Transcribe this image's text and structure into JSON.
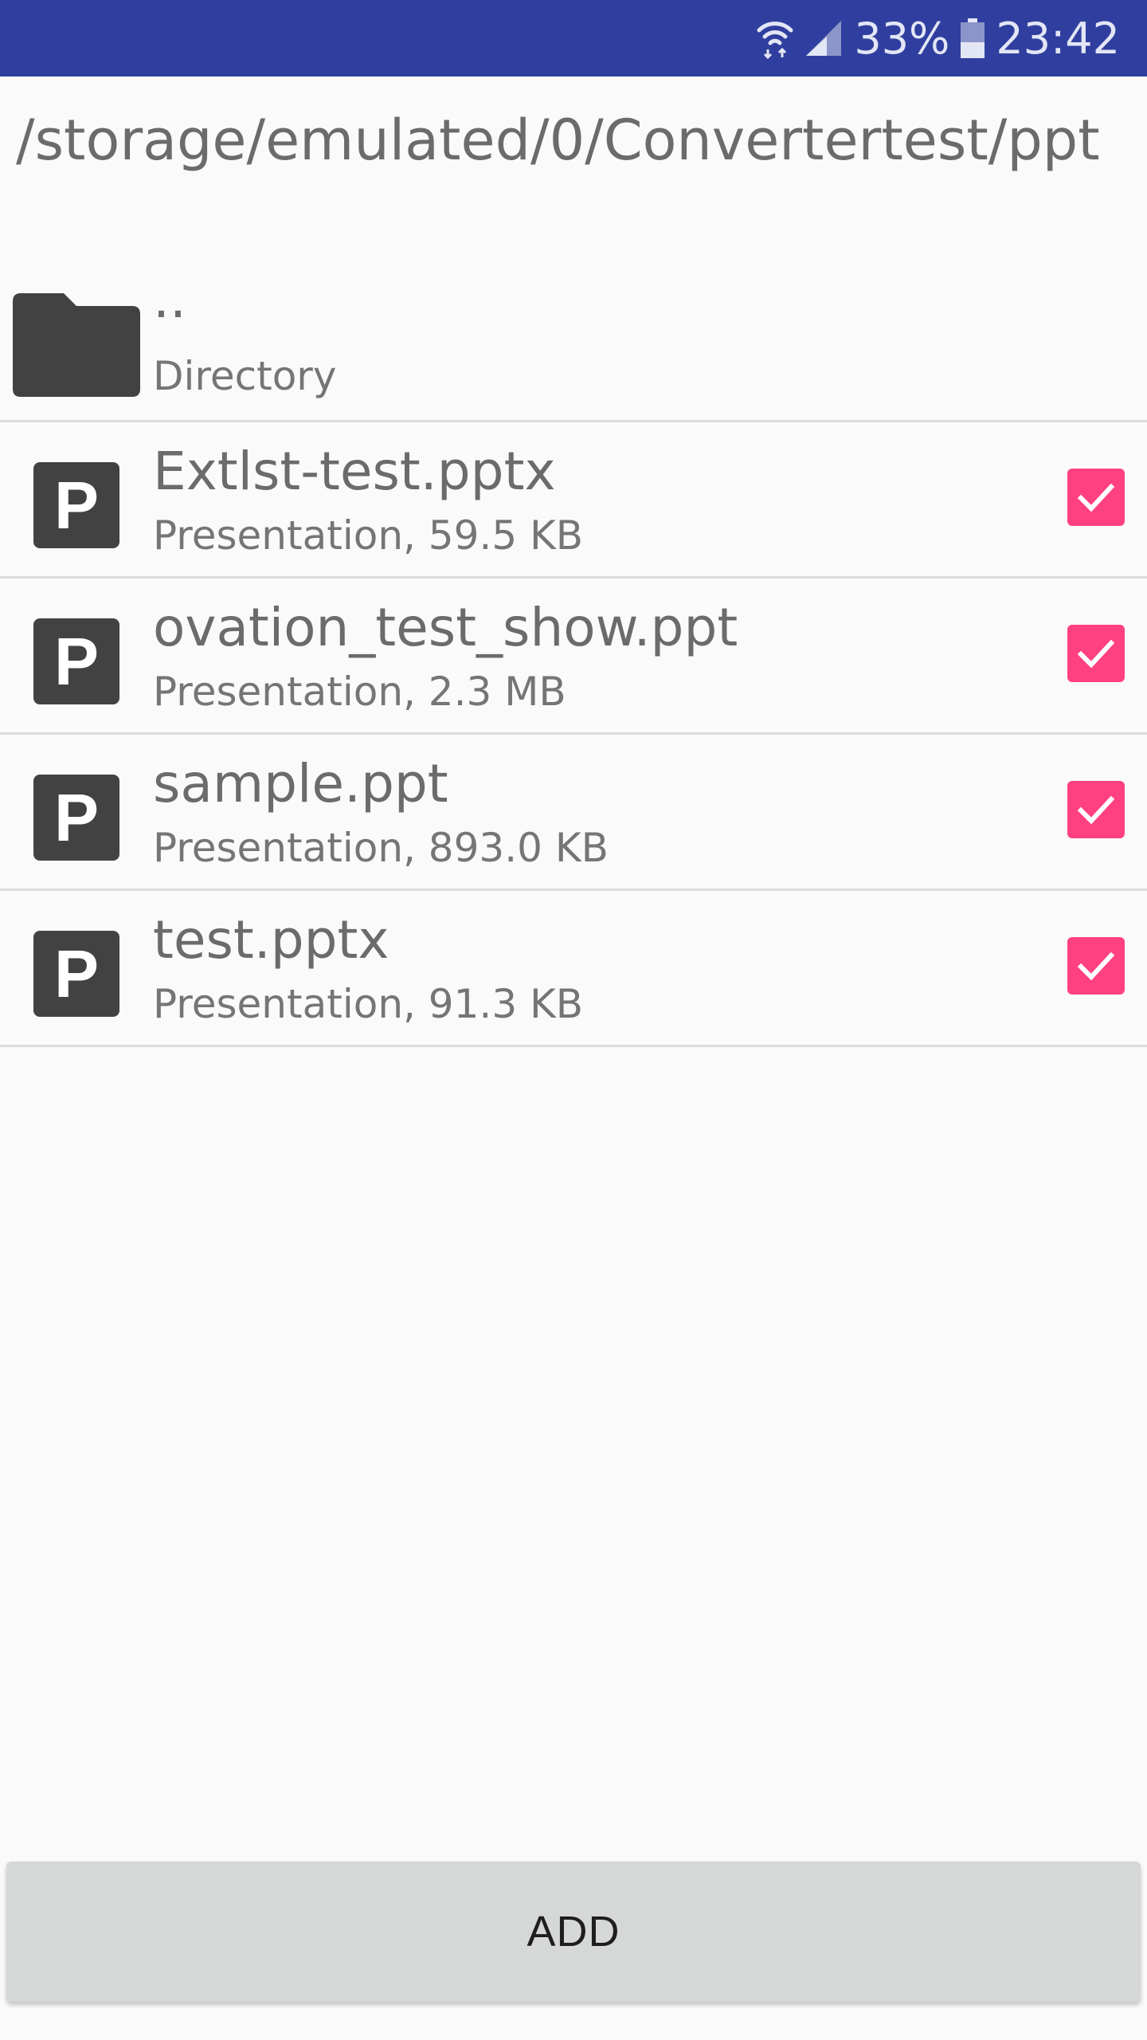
{
  "status_bar": {
    "battery_percent": "33%",
    "time": "23:42",
    "icons": [
      "wifi-icon",
      "signal-icon",
      "battery-icon"
    ]
  },
  "path": "/storage/emulated/0/Convertertest/ppt",
  "directory_entry": {
    "name": "..",
    "type": "Directory",
    "icon": "folder-icon"
  },
  "files": [
    {
      "name": "Extlst-test.pptx",
      "details": "Presentation, 59.5 KB",
      "icon": "ppt-icon",
      "checked": true
    },
    {
      "name": "ovation_test_show.ppt",
      "details": "Presentation, 2.3 MB",
      "icon": "ppt-icon",
      "checked": true
    },
    {
      "name": "sample.ppt",
      "details": "Presentation, 893.0 KB",
      "icon": "ppt-icon",
      "checked": true
    },
    {
      "name": "test.pptx",
      "details": "Presentation, 91.3 KB",
      "icon": "ppt-icon",
      "checked": true
    }
  ],
  "ppt_icon_letter": "P",
  "add_button_label": "ADD",
  "colors": {
    "status_bar": "#303f9f",
    "checkbox": "#ff4081",
    "icon_dark": "#424242",
    "background": "#fafafa"
  }
}
